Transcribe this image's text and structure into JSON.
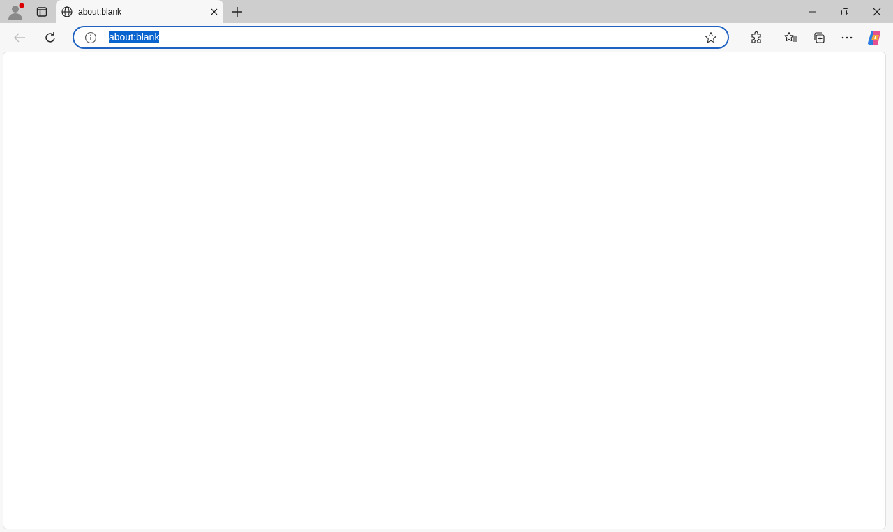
{
  "tabs": [
    {
      "title": "about:blank",
      "selected": true
    }
  ],
  "toolbar": {
    "back_disabled": true
  },
  "address_bar": {
    "value": "about:blank",
    "text_selected": true,
    "focused": true
  }
}
